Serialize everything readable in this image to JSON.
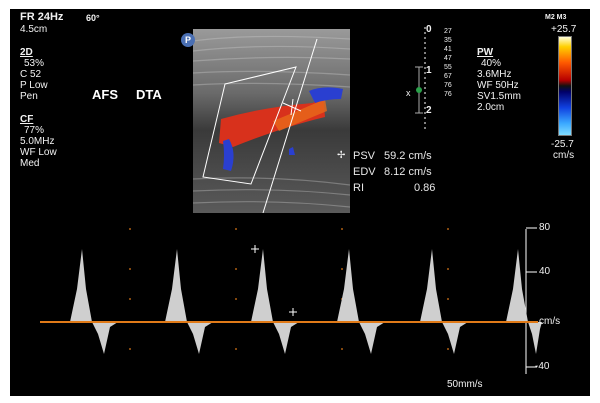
{
  "header": {
    "frame_rate": "FR 24Hz",
    "angle": "60°",
    "depth": "4.5cm"
  },
  "twod": {
    "title": "2D",
    "lines": [
      "53%",
      "C 52",
      "P Low",
      "Pen"
    ]
  },
  "cf": {
    "title": "CF",
    "lines": [
      "77%",
      "5.0MHz",
      "WF Low",
      "Med"
    ]
  },
  "labels": {
    "afs": "AFS",
    "dta": "DTA"
  },
  "probe_badge": "P",
  "depth_scale": {
    "ticks": [
      "0",
      "1",
      "2"
    ],
    "gate_label": "x"
  },
  "freq_column": [
    "27",
    "35",
    "41",
    "47",
    "55",
    "67",
    "76",
    "76"
  ],
  "pw": {
    "title": "PW",
    "lines": [
      "40%",
      "3.6MHz",
      "WF 50Hz",
      "SV1.5mm",
      "2.0cm"
    ]
  },
  "color_map": {
    "name": "M2 M3",
    "max": "+25.7",
    "min": "-25.7",
    "unit": "cm/s"
  },
  "measurements": {
    "psv_label": "PSV",
    "psv_value": "59.2 cm/s",
    "edv_label": "EDV",
    "edv_value": "8.12 cm/s",
    "ri_label": "RI",
    "ri_value": "0.86"
  },
  "doppler_scale": {
    "ticks": [
      "80",
      "40",
      "cm/s",
      "-40"
    ],
    "sweep": "50mm/s"
  },
  "colors": {
    "baseline": "#e07a18",
    "flow_red": "#d8311c",
    "flow_blue": "#1c46d8"
  }
}
